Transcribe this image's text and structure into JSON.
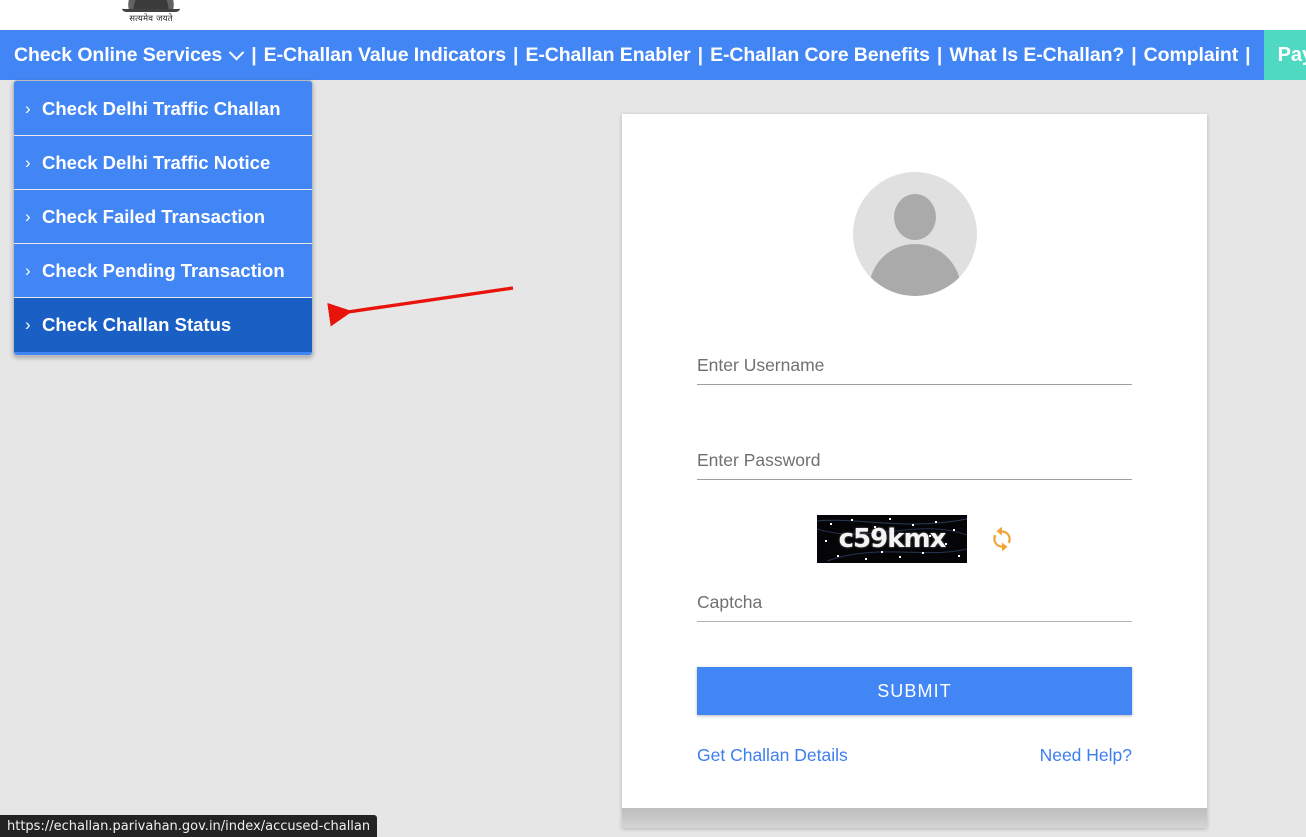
{
  "emblem": {
    "caption": "सत्यमेव जयते",
    "icon": "ashoka-emblem-icon"
  },
  "navbar": {
    "background_color": "#4285f4",
    "separator": "|",
    "items": [
      {
        "label": "Check Online Services",
        "has_chevron": true
      },
      {
        "label": "E-Challan Value Indicators",
        "has_chevron": false
      },
      {
        "label": "E-Challan Enabler",
        "has_chevron": false
      },
      {
        "label": "E-Challan Core Benefits",
        "has_chevron": false
      },
      {
        "label": "What Is E-Challan?",
        "has_chevron": false
      },
      {
        "label": "Complaint",
        "has_chevron": false
      }
    ],
    "pay_button": {
      "label": "Pay",
      "color": "#4fd9c2"
    }
  },
  "dropdown": {
    "bullet": "›",
    "active_color": "#1a5fc4",
    "items": [
      {
        "label": "Check Delhi Traffic Challan",
        "active": false
      },
      {
        "label": "Check Delhi Traffic Notice",
        "active": false
      },
      {
        "label": "Check Failed Transaction",
        "active": false
      },
      {
        "label": "Check Pending Transaction",
        "active": false
      },
      {
        "label": "Check Challan Status",
        "active": true
      }
    ]
  },
  "annotation": {
    "type": "red-arrow",
    "color": "#e8140c",
    "points_to": "Check Challan Status"
  },
  "login_card": {
    "avatar_icon": "user-avatar-icon",
    "username": {
      "value": "",
      "placeholder": "Enter Username"
    },
    "password": {
      "value": "",
      "placeholder": "Enter Password"
    },
    "captcha": {
      "image_text": "c59kmx",
      "refresh_icon": "refresh-icon",
      "refresh_color": "#f0a43a",
      "input": {
        "value": "",
        "placeholder": "Captcha"
      }
    },
    "submit_label": "SUBMIT",
    "links": {
      "left": "Get Challan Details",
      "right": "Need Help?"
    },
    "link_color": "#3d7ef0",
    "button_color": "#4285f4"
  },
  "status_bar": {
    "url": "https://echallan.parivahan.gov.in/index/accused-challan"
  }
}
